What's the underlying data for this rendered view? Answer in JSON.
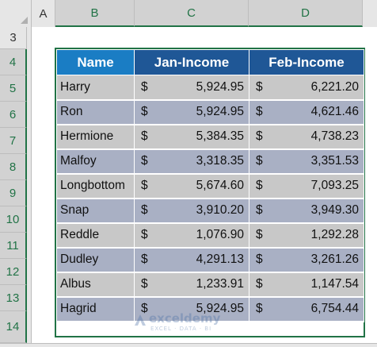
{
  "columns": {
    "a": "A",
    "b": "B",
    "c": "C",
    "d": "D"
  },
  "rows": [
    "3",
    "4",
    "5",
    "6",
    "7",
    "8",
    "9",
    "10",
    "11",
    "12",
    "13",
    "14"
  ],
  "table": {
    "headers": {
      "name": "Name",
      "jan": "Jan-Income",
      "feb": "Feb-Income"
    },
    "currency": "$",
    "records": [
      {
        "name": "Harry",
        "jan": "5,924.95",
        "feb": "6,221.20"
      },
      {
        "name": "Ron",
        "jan": "5,924.95",
        "feb": "4,621.46"
      },
      {
        "name": "Hermione",
        "jan": "5,384.35",
        "feb": "4,738.23"
      },
      {
        "name": "Malfoy",
        "jan": "3,318.35",
        "feb": "3,351.53"
      },
      {
        "name": "Longbottom",
        "jan": "5,674.60",
        "feb": "7,093.25"
      },
      {
        "name": "Snap",
        "jan": "3,910.20",
        "feb": "3,949.30"
      },
      {
        "name": "Reddle",
        "jan": "1,076.90",
        "feb": "1,292.28"
      },
      {
        "name": "Dudley",
        "jan": "4,291.13",
        "feb": "3,261.26"
      },
      {
        "name": "Albus",
        "jan": "1,233.91",
        "feb": "1,147.54"
      },
      {
        "name": "Hagrid",
        "jan": "5,924.95",
        "feb": "6,754.44"
      }
    ]
  },
  "watermark": {
    "main": "exceldemy",
    "sub": "EXCEL · DATA · BI"
  },
  "colors": {
    "header_dark": "#1f5796",
    "header_light": "#1a7dc4",
    "row_grey": "#c8c8c8",
    "row_blue": "#a9b0c4",
    "excel_green": "#217346"
  }
}
